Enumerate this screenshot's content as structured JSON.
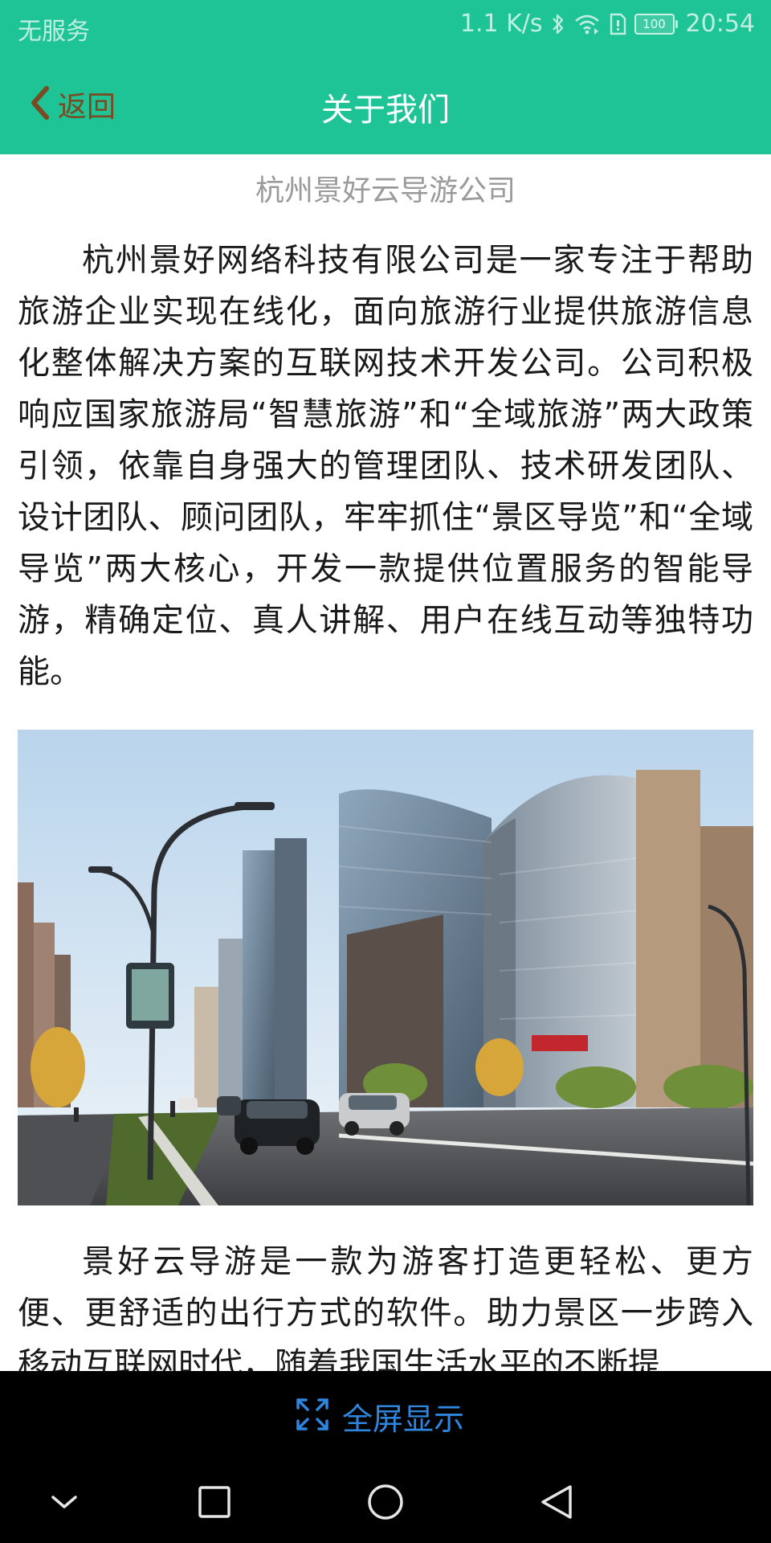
{
  "status_bar": {
    "carrier": "无服务",
    "net_speed": "1.1 K/s",
    "battery_level": "100",
    "time": "20:54",
    "icons": [
      "bluetooth-icon",
      "wifi-icon",
      "sim-icon",
      "battery-icon"
    ]
  },
  "header": {
    "back_label": "返回",
    "title": "关于我们"
  },
  "article": {
    "heading": "杭州景好云导游公司",
    "paragraph1": "杭州景好网络科技有限公司是一家专注于帮助旅游企业实现在线化，面向旅游行业提供旅游信息化整体解决方案的互联网技术开发公司。公司积极响应国家旅游局“智慧旅游”和“全域旅游”两大政策引领，依靠自身强大的管理团队、技术研发团队、设计团队、顾问团队，牢牢抓住“景区导览”和“全域导览”两大核心，开发一款提供位置服务的智能导游，精确定位、真人讲解、用户在线互动等独特功能。",
    "paragraph2": "景好云导游是一款为游客打造更轻松、更方便、更舒适的出行方式的软件。助力景区一步跨入移动互联网时代，随着我国生活水平的不断提"
  },
  "footer": {
    "fullscreen_label": "全屏显示"
  },
  "nav": {
    "icons": [
      "nav-down-icon",
      "nav-recents-icon",
      "nav-home-icon",
      "nav-back-icon"
    ]
  },
  "colors": {
    "header_bg": "#1ec396",
    "back_text": "#7a4a23",
    "fullscreen_accent": "#2e86de",
    "heading_gray": "#9a9a9a"
  }
}
